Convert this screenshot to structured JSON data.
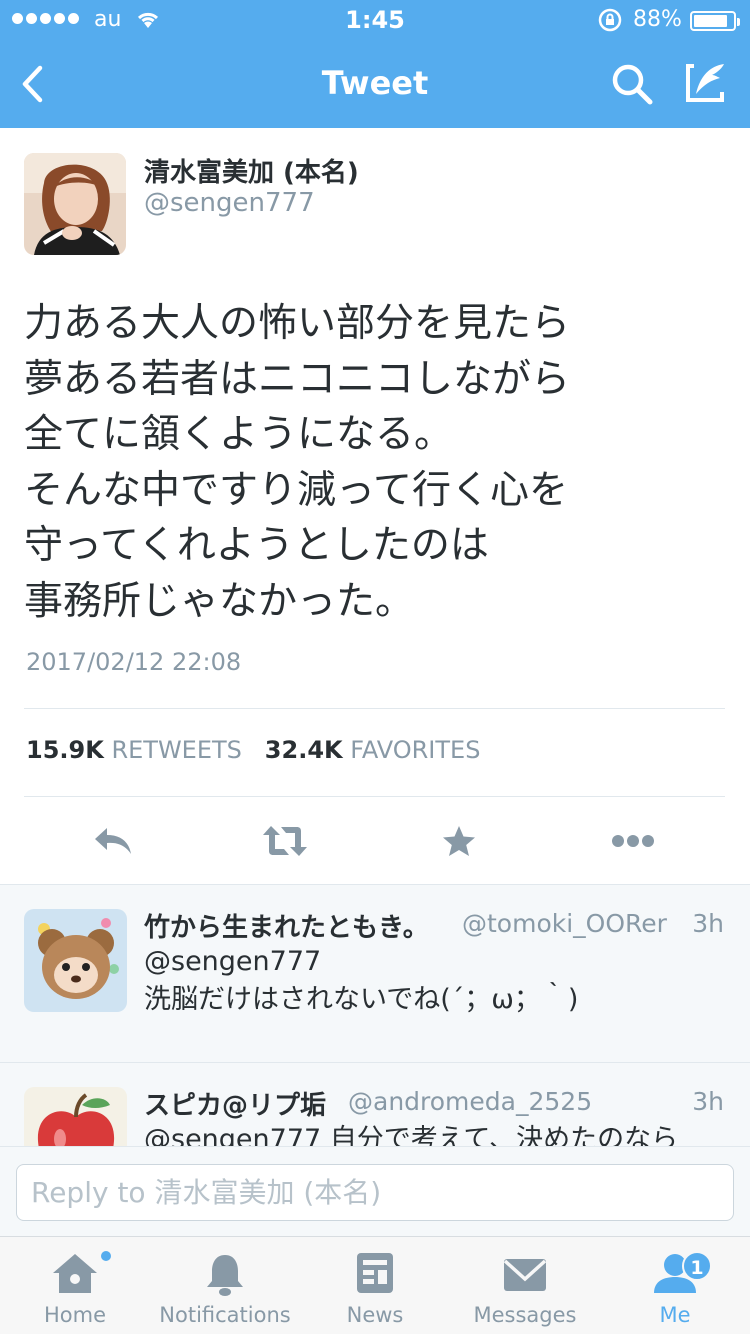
{
  "status_bar": {
    "carrier": "au",
    "time": "1:45",
    "battery_percent": "88%",
    "battery_level": 0.88
  },
  "nav": {
    "title": "Tweet"
  },
  "tweet": {
    "author_name": "清水富美加 (本名)",
    "author_handle": "@sengen777",
    "text": "力ある大人の怖い部分を見たら\n夢ある若者はニコニコしながら\n全てに頷くようになる。\nそんな中ですり減って行く心を\n守ってくれようとしたのは\n事務所じゃなかった。",
    "date": "2017/02/12 22:08",
    "retweets_count": "15.9K",
    "retweets_label": "RETWEETS",
    "favorites_count": "32.4K",
    "favorites_label": "FAVORITES"
  },
  "replies": [
    {
      "name": "竹から生まれたともき。",
      "handle": "@tomoki_OORer",
      "time": "3h",
      "text": "@sengen777\n洗脳だけはされないでね(´；ω；｀)"
    },
    {
      "name": "スピカ@リプ垢",
      "handle": "@andromeda_2525",
      "time": "3h",
      "text": "@sengen777 自分で考えて、決めたのなら"
    }
  ],
  "reply_bar": {
    "placeholder": "Reply to 清水富美加 (本名)"
  },
  "tabs": [
    {
      "label": "Home"
    },
    {
      "label": "Notifications"
    },
    {
      "label": "News"
    },
    {
      "label": "Messages"
    },
    {
      "label": "Me",
      "badge": "1"
    }
  ],
  "colors": {
    "brand": "#55acee",
    "text": "#292f33",
    "muted": "#8899a6",
    "divider": "#e1e8ed"
  }
}
